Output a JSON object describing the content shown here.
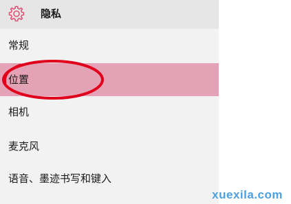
{
  "header": {
    "icon": "gear-icon",
    "title": "隐私",
    "accent_color": "#e0527a"
  },
  "nav": {
    "items": [
      {
        "label": "常规"
      },
      {
        "label": "位置",
        "selected": true
      },
      {
        "label": "相机"
      },
      {
        "label": "麦克风"
      },
      {
        "label": "语音、墨迹书写和键入"
      }
    ],
    "selected_color": "#e4a2b6"
  },
  "annotation": {
    "shape": "ellipse",
    "color": "#e0001b",
    "target": "位置"
  },
  "watermark": {
    "text": "xuexila.com"
  }
}
